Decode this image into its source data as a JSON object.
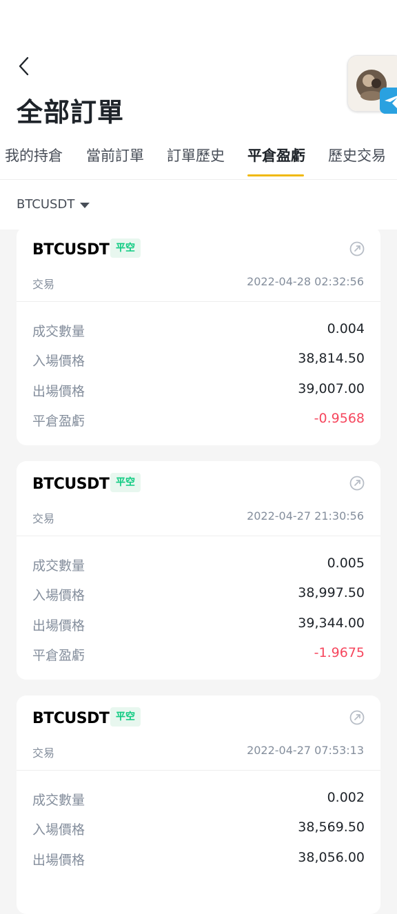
{
  "header": {
    "title": "全部訂單"
  },
  "tabs": [
    {
      "label": "我的持倉",
      "active": false
    },
    {
      "label": "當前訂單",
      "active": false
    },
    {
      "label": "訂單歷史",
      "active": false
    },
    {
      "label": "平倉盈虧",
      "active": true
    },
    {
      "label": "歷史交易",
      "active": false
    }
  ],
  "filter": {
    "symbol": "BTCUSDT"
  },
  "colors": {
    "accent": "#f0b90b",
    "positive": "#0ecb81",
    "negative": "#f6465d",
    "telegram": "#2aa1e0"
  },
  "labels": {
    "qty": "成交數量",
    "entry": "入場價格",
    "exit": "出場價格",
    "pnl": "平倉盈虧"
  },
  "orders": [
    {
      "symbol": "BTCUSDT",
      "side": "平空",
      "type": "交易",
      "time": "2022-04-28 02:32:56",
      "qty": "0.004",
      "entry": "38,814.50",
      "exit": "39,007.00",
      "pnl": "-0.9568"
    },
    {
      "symbol": "BTCUSDT",
      "side": "平空",
      "type": "交易",
      "time": "2022-04-27 21:30:56",
      "qty": "0.005",
      "entry": "38,997.50",
      "exit": "39,344.00",
      "pnl": "-1.9675"
    },
    {
      "symbol": "BTCUSDT",
      "side": "平空",
      "type": "交易",
      "time": "2022-04-27 07:53:13",
      "qty": "0.002",
      "entry": "38,569.50",
      "exit": "38,056.00",
      "pnl": ""
    }
  ]
}
